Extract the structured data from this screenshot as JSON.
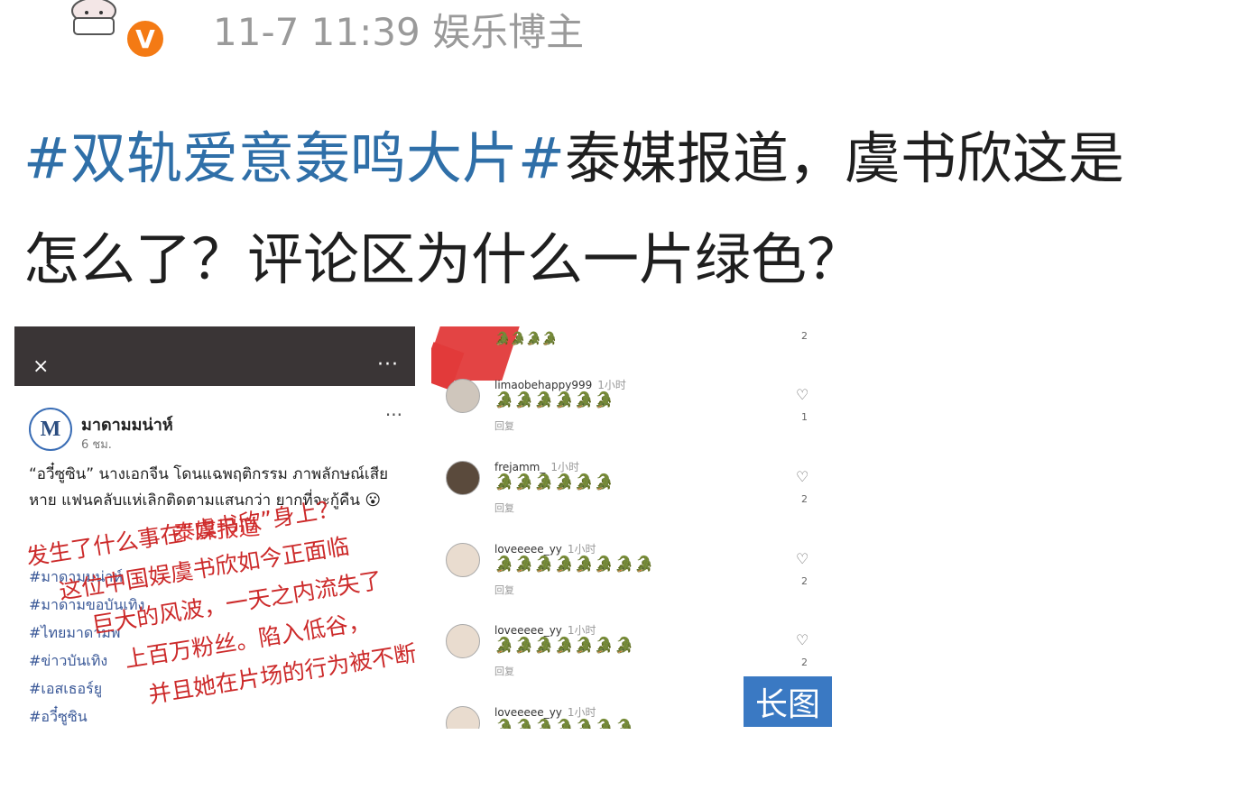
{
  "header": {
    "verified_badge": "V",
    "timestamp": "11-7 11:39",
    "user_tag": "娱乐博主"
  },
  "post": {
    "hashtag": "#双轨爱意轰鸣大片#",
    "text_line1": "泰媒报道，虞书欣这是",
    "text_line2": "怎么了？评论区为什么一片绿色？"
  },
  "left_image": {
    "close_icon": "×",
    "more_icon": "···",
    "page_logo_letter": "M",
    "page_name": "มาดามมน่าห์",
    "post_time": "6 ชม.",
    "post_body": "“อวี๋ซูซิน” นางเอกจีน โดนแฉพฤติกรรม ภาพลักษณ์เสียหาย แฟนคลับแห่เลิกติดตามแสนกว่า ยากที่จะกู้คืน 😮",
    "tags": [
      "#มาดามมน่าห์",
      "#มาดามขอบันเทิง",
      "#ไทยมาดามพ",
      "#ข่าวบันเทิง",
      "#เอสเธอร์ยู",
      "#อวี๋ซูซิน"
    ],
    "overlay_title": "泰媒报道",
    "overlay_lines": [
      "发生了什么事在“虞书欣”身上？",
      "这位中国娱虞书欣如今正面临",
      "巨大的风波，一天之内流失了",
      "上百万粉丝。陷入低谷，",
      "并且她在片场的行为被不断曝光"
    ]
  },
  "right_image": {
    "top_snippet": "🐊🐊🐊🐊",
    "top_count": "2",
    "comments": [
      {
        "user": "limaobehappy999",
        "time": "1小时",
        "body": "🐊🐊🐊🐊🐊🐊",
        "reply": "回复",
        "likes": "1"
      },
      {
        "user": "frejamm_",
        "time": "1小时",
        "body": "🐊🐊🐊🐊🐊🐊",
        "reply": "回复",
        "likes": "2"
      },
      {
        "user": "loveeeee_yy",
        "time": "1小时",
        "body": "🐊🐊🐊🐊🐊🐊🐊🐊",
        "reply": "回复",
        "likes": "2"
      },
      {
        "user": "loveeeee_yy",
        "time": "1小时",
        "body": "🐊🐊🐊🐊🐊🐊🐊",
        "reply": "回复",
        "likes": "2"
      },
      {
        "user": "loveeeee_yy",
        "time": "1小时",
        "body": "🐊🐊🐊🐊🐊🐊🐊",
        "reply": "",
        "likes": ""
      }
    ]
  },
  "long_image_badge": "长图"
}
